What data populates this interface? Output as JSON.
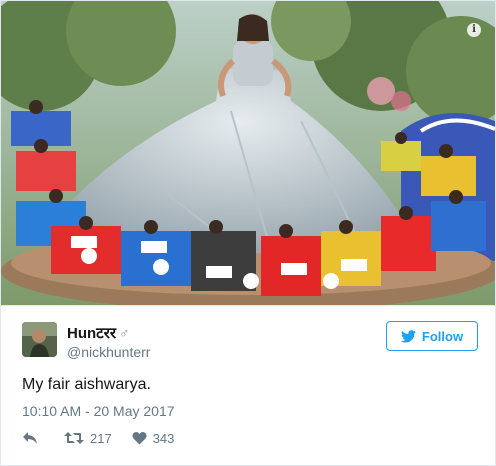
{
  "media": {
    "alt_icon": "info-icon",
    "info_glyph": "i"
  },
  "author": {
    "display_name": "Hunटरर",
    "gender_symbol": "♂",
    "handle": "@nickhunterr"
  },
  "follow_button": {
    "label": "Follow",
    "icon": "twitter-bird-icon",
    "color": "#1da1f2"
  },
  "tweet": {
    "text": "My fair aishwarya.",
    "timestamp": "10:10 AM - 20 May 2017"
  },
  "actions": {
    "reply_icon": "reply-icon",
    "retweet_icon": "retweet-icon",
    "retweet_count": "217",
    "like_icon": "heart-icon",
    "like_count": "343"
  }
}
